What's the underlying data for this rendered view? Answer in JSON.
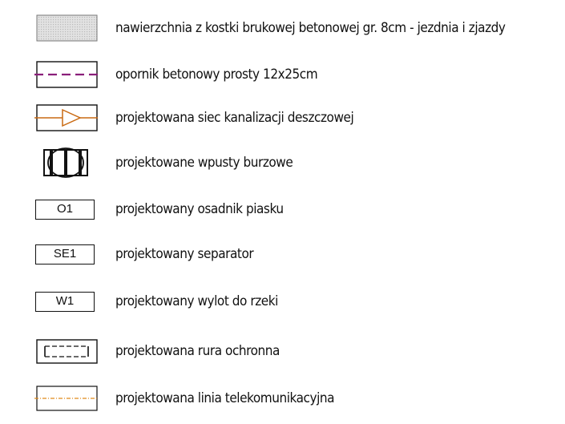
{
  "legend": {
    "items": [
      {
        "symbol": "paving-stone-hatch-icon",
        "label": "nawierzchnia z kostki brukowej betonowej gr. 8cm - jezdnia i zjazdy"
      },
      {
        "symbol": "curb-dashed-line-icon",
        "label": "opornik betonowy prosty 12x25cm"
      },
      {
        "symbol": "storm-sewer-arrow-icon",
        "label": "projektowana siec kanalizacji deszczowej"
      },
      {
        "symbol": "storm-inlet-icon",
        "label": "projektowane wpusty burzowe"
      },
      {
        "symbol": "sand-trap-box-icon",
        "code": "O1",
        "label": "projektowany osadnik piasku"
      },
      {
        "symbol": "separator-box-icon",
        "code": "SE1",
        "label": "projektowany separator"
      },
      {
        "symbol": "outlet-box-icon",
        "code": "W1",
        "label": "projektowany wylot do rzeki"
      },
      {
        "symbol": "protective-pipe-icon",
        "label": "projektowana rura ochronna"
      },
      {
        "symbol": "telecom-line-icon",
        "label": "projektowana linia telekomunikacyjna"
      }
    ]
  },
  "colors": {
    "curb_line": "#8a1f7a",
    "storm_sewer": "#c96a12",
    "telecom_line": "#e08a1a",
    "hatch_fill": "#d8d8d8",
    "ink": "#111111"
  }
}
